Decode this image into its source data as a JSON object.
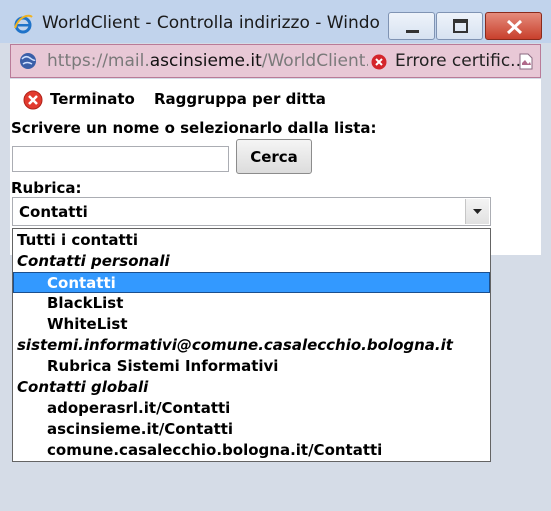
{
  "window": {
    "title": "WorldClient - Controlla indirizzo - Windo...",
    "icon": "ie-icon",
    "controls": [
      "minimize-icon",
      "maximize-icon",
      "close-icon"
    ]
  },
  "address_bar": {
    "url_prefix": "https://mail.",
    "url_host": "ascinsieme.it",
    "url_suffix": "/WorldClient.dl",
    "cert_error": "Errore certific...",
    "colors": {
      "background": "#e8c8d6",
      "error": "#d4252b"
    }
  },
  "toolbar": {
    "done_label": "Terminato",
    "group_label": "Raggruppa per ditta"
  },
  "form": {
    "instruction": "Scrivere un nome o selezionarlo dalla lista:",
    "name_value": "",
    "search_label": "Cerca",
    "addressbook_label": "Rubrica:",
    "addressbook_selected": "Contatti"
  },
  "dropdown": {
    "items": [
      {
        "label": "Tutti i contatti",
        "kind": "option"
      },
      {
        "label": "Contatti personali",
        "kind": "group"
      },
      {
        "label": "Contatti",
        "kind": "option",
        "selected": true
      },
      {
        "label": "BlackList",
        "kind": "option"
      },
      {
        "label": "WhiteList",
        "kind": "option"
      },
      {
        "label": "sistemi.informativi@comune.casalecchio.bologna.it",
        "kind": "group"
      },
      {
        "label": "Rubrica Sistemi Informativi",
        "kind": "option"
      },
      {
        "label": "Contatti globali",
        "kind": "group"
      },
      {
        "label": "adoperasrl.it/Contatti",
        "kind": "option"
      },
      {
        "label": "ascinsieme.it/Contatti",
        "kind": "option"
      },
      {
        "label": "comune.casalecchio.bologna.it/Contatti",
        "kind": "option"
      }
    ],
    "colors": {
      "selected_bg": "#3399ff"
    }
  }
}
